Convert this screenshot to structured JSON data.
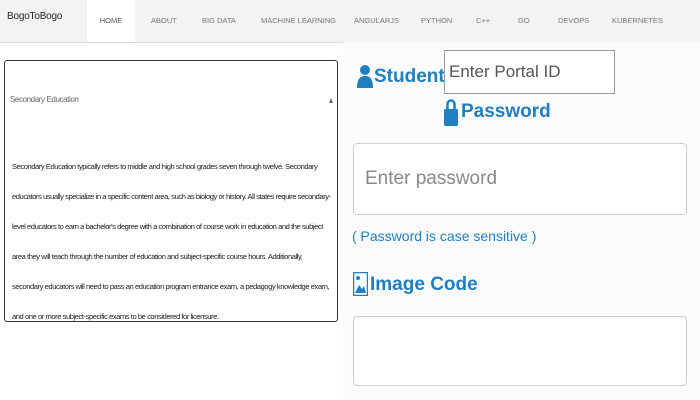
{
  "brand": "BogoToBogo",
  "nav": {
    "items": [
      {
        "label": "HOME"
      },
      {
        "label": "ABOUT"
      },
      {
        "label": "BIG DATA"
      },
      {
        "label": "MACHINE LEARNING"
      },
      {
        "label": "ANGULARJS"
      },
      {
        "label": "PYTHON"
      },
      {
        "label": "C++"
      },
      {
        "label": "GO"
      },
      {
        "label": "DEVOPS"
      },
      {
        "label": "KUBERNETES"
      }
    ],
    "active": "HOME"
  },
  "panel": {
    "title": "Secondary Education",
    "body": "Secondary Education typically refers to middle and high school grades seven through twelve. Secondary educators usually specialize in a specific content area, such as biology or history. All states require secondary-level educators to earn a bachelor's degree with a combination of course work in education and the subject area they will teach through the number of education and subject-specific course hours. Additionally, secondary educators will need to pass an education program entrance exam, a pedagogy knowledge exam, and one or more subject-specific exams to be considered for licensure."
  },
  "login": {
    "student_id_label": "Student ID",
    "portal_placeholder": "Enter Portal ID",
    "password_label": "Password",
    "password_placeholder": "Enter password",
    "case_note": "( Password is case sensitive )",
    "image_code_label": "Image Code"
  },
  "icons": {
    "user": "user-icon",
    "lock": "lock-icon",
    "image": "image-icon"
  },
  "colors": {
    "accent": "#1f7fc1",
    "navbar": "#f3f3f3"
  }
}
